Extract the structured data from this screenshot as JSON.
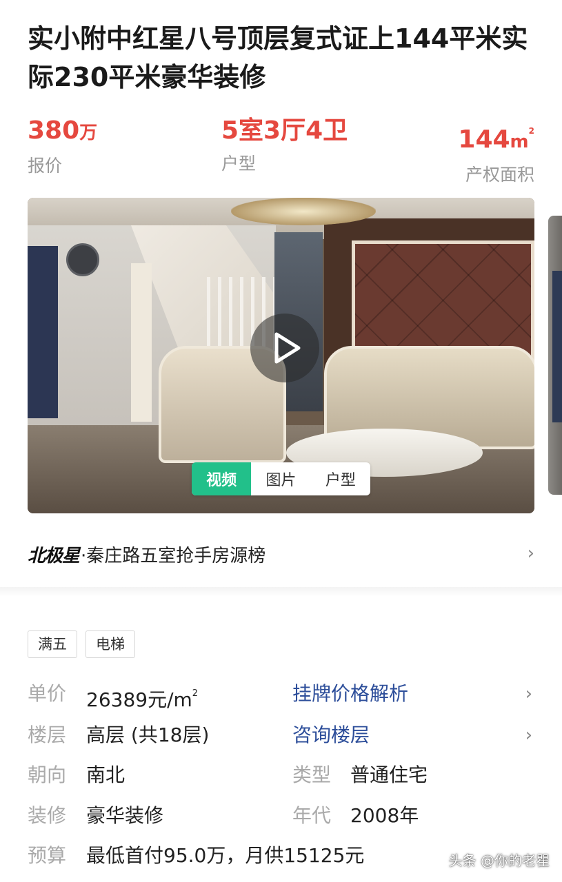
{
  "listing": {
    "title": "实小附中红星八号顶层复式证上144平米实际230平米豪华装修"
  },
  "stats": {
    "price_value": "380",
    "price_unit": "万",
    "price_label": "报价",
    "layout_value": "5室3厅4卫",
    "layout_label": "户型",
    "area_value": "144",
    "area_unit": "m",
    "area_sup": "2",
    "area_label": "产权面积"
  },
  "gallery": {
    "tabs": [
      {
        "label": "视频",
        "active": true
      },
      {
        "label": "图片",
        "active": false
      },
      {
        "label": "户型",
        "active": false
      }
    ],
    "play_icon": "play-icon"
  },
  "rank": {
    "brand": "北极星",
    "text": "·秦庄路五室抢手房源榜"
  },
  "tags": [
    "满五",
    "电梯"
  ],
  "info": {
    "unit_price": {
      "key": "单价",
      "value": "26389元/m",
      "sup": "2",
      "link": "挂牌价格解析"
    },
    "floor": {
      "key": "楼层",
      "value": "高层 (共18层)",
      "link": "咨询楼层"
    },
    "orientation": {
      "key": "朝向",
      "value": "南北",
      "key2": "类型",
      "value2": "普通住宅"
    },
    "decoration": {
      "key": "装修",
      "value": "豪华装修",
      "key2": "年代",
      "value2": "2008年"
    },
    "budget": {
      "key": "预算",
      "value": "最低首付95.0万，月供15125元"
    }
  },
  "watermark": "头条 @你的老瞿",
  "colors": {
    "accent_red": "#e5483f",
    "accent_green": "#22c08a",
    "link_blue": "#2d4e9a"
  }
}
